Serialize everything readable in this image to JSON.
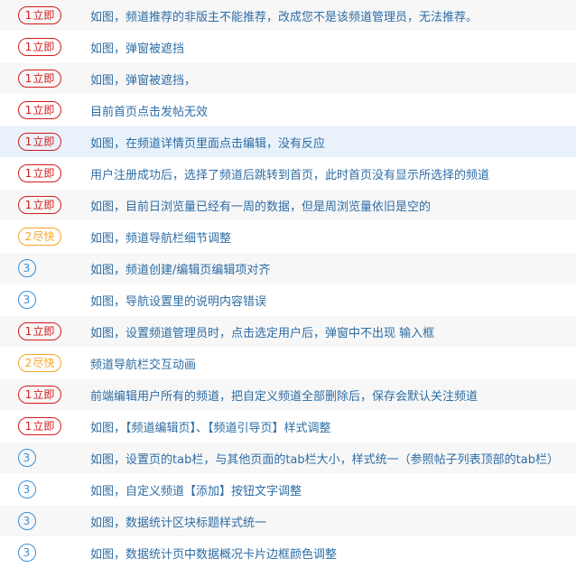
{
  "colors": {
    "urgent": "#d41c1c",
    "soon": "#f5a623",
    "normal": "#3a8fd6",
    "text": "#2e6da4",
    "row_alt": "#f7f7f7",
    "row_highlight": "#e9f2fb"
  },
  "rows": [
    {
      "num": "1",
      "label": "立即",
      "priority": "urgent",
      "text": "如图，频道推荐的非版主不能推荐，改成您不是该频道管理员，无法推荐。"
    },
    {
      "num": "1",
      "label": "立即",
      "priority": "urgent",
      "text": "如图，弹窗被遮挡"
    },
    {
      "num": "1",
      "label": "立即",
      "priority": "urgent",
      "text": "如图，弹窗被遮挡，"
    },
    {
      "num": "1",
      "label": "立即",
      "priority": "urgent",
      "text": "目前首页点击发帖无效"
    },
    {
      "num": "1",
      "label": "立即",
      "priority": "urgent",
      "text": "如图，在频道详情页里面点击编辑，没有反应",
      "highlight": true
    },
    {
      "num": "1",
      "label": "立即",
      "priority": "urgent",
      "text": "用户注册成功后，选择了频道后跳转到首页，此时首页没有显示所选择的频道"
    },
    {
      "num": "1",
      "label": "立即",
      "priority": "urgent",
      "text": "如图，目前日浏览量已经有一周的数据，但是周浏览量依旧是空的"
    },
    {
      "num": "2",
      "label": "尽快",
      "priority": "soon",
      "text": "如图，频道导航栏细节调整"
    },
    {
      "num": "3",
      "label": "",
      "priority": "normal",
      "text": "如图，频道创建/编辑页编辑项对齐"
    },
    {
      "num": "3",
      "label": "",
      "priority": "normal",
      "text": "如图，导航设置里的说明内容错误"
    },
    {
      "num": "1",
      "label": "立即",
      "priority": "urgent",
      "text": "如图，设置频道管理员时，点击选定用户后，弹窗中不出现 输入框"
    },
    {
      "num": "2",
      "label": "尽快",
      "priority": "soon",
      "text": "频道导航栏交互动画"
    },
    {
      "num": "1",
      "label": "立即",
      "priority": "urgent",
      "text": "前端编辑用户所有的频道，把自定义频道全部删除后，保存会默认关注频道"
    },
    {
      "num": "1",
      "label": "立即",
      "priority": "urgent",
      "text": "如图，【频道编辑页】、【频道引导页】样式调整"
    },
    {
      "num": "3",
      "label": "",
      "priority": "normal",
      "text": "如图，设置页的tab栏，与其他页面的tab栏大小，样式统一（参照帖子列表顶部的tab栏）"
    },
    {
      "num": "3",
      "label": "",
      "priority": "normal",
      "text": "如图，自定义频道【添加】按钮文字调整"
    },
    {
      "num": "3",
      "label": "",
      "priority": "normal",
      "text": "如图，数据统计区块标题样式统一"
    },
    {
      "num": "3",
      "label": "",
      "priority": "normal",
      "text": "如图，数据统计页中数据概况卡片边框颜色调整"
    }
  ]
}
